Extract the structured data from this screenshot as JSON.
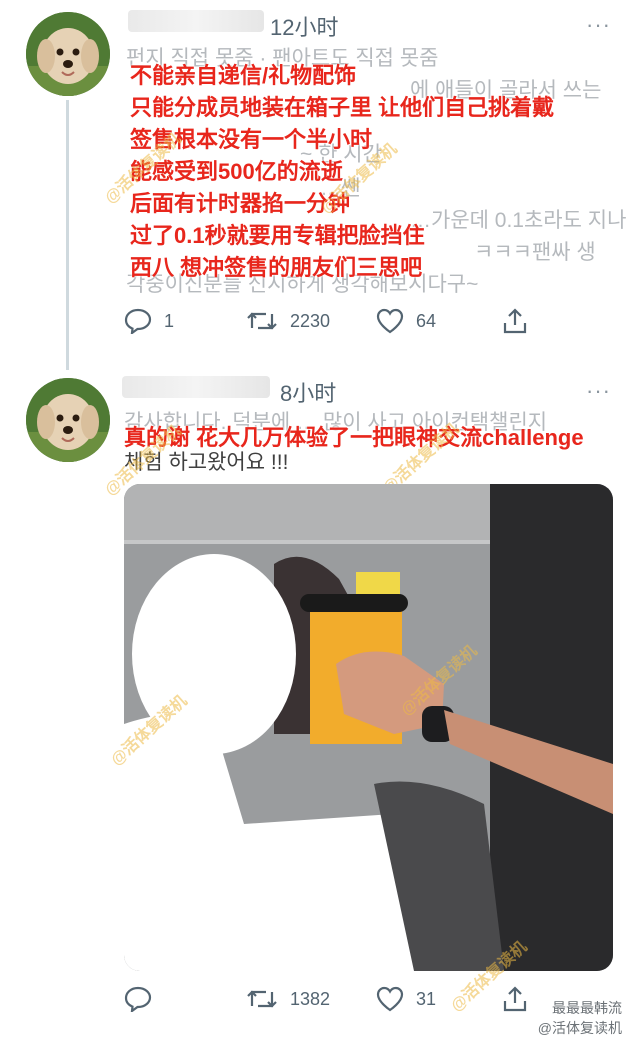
{
  "tweet1": {
    "time": "12小时",
    "more": "···",
    "ghost_lines": [
      "펀지 직접 못줌 · 팬아트도 직접 못줌",
      "에 애들이 골라서 쓰는",
      "~ 한 시간",
      "",
      "…쎈",
      "…가운데 0.1초라도 지나",
      "ㅋㅋㅋ팬싸 생",
      "각중이신분들 신시하게 생각해보시다구~"
    ],
    "overlay_lines": [
      "不能亲自递信/礼物配饰",
      "只能分成员地装在箱子里 让他们自己挑着戴",
      "签售根本没有一个半小时",
      "能感受到500亿的流逝",
      "后面有计时器掐一分钟",
      "过了0.1秒就要用专辑把脸挡住",
      "西八 想冲签售的朋友们三思吧"
    ],
    "replies": "1",
    "retweets": "2230",
    "likes": "64"
  },
  "tweet2": {
    "time": "8小时",
    "more": "···",
    "ghost_lines": [
      "감사합니다. 덕분에 …  많이 사고 아이컨택챌린지",
      "체험 하고왔어요 !!!"
    ],
    "overlay_line": "真的谢 花大几万体验了一把眼神交流challenge",
    "replies": "",
    "retweets": "1382",
    "likes": "31"
  },
  "watermark": "@活体复读机",
  "footer": {
    "line1": "最最最韩流",
    "line2": "@活体复读机"
  },
  "icons": [
    "reply-icon",
    "retweet-icon",
    "like-icon",
    "share-icon",
    "more-icon"
  ],
  "colors": {
    "overlay_red": "#e8261c",
    "muted": "#536471",
    "watermark": "#ecba46"
  }
}
